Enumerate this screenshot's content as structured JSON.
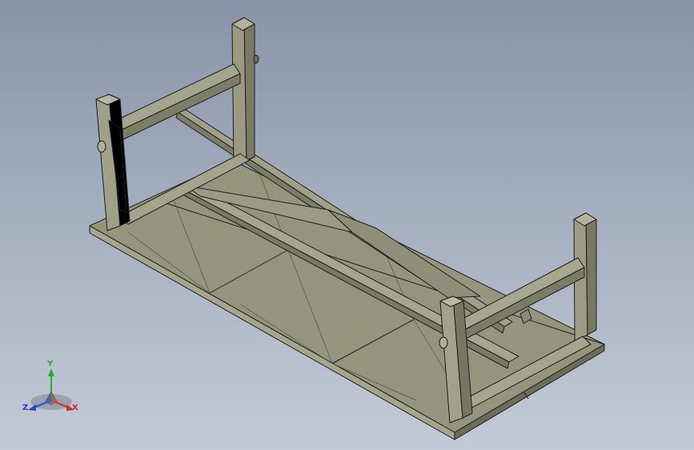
{
  "viewport": {
    "background_top": "#8793a7",
    "background_bottom": "#c3cad6"
  },
  "model": {
    "object": "table-bottom-view",
    "face_color": "#8f8f78",
    "light_face_color": "#a3a38c",
    "dark_face_color": "#74745f",
    "edge_color": "#1e1e1a"
  },
  "triad": {
    "y_label": "Y",
    "x_label": "X",
    "z_label": "Z",
    "y_color": "#1fae2f",
    "x_color": "#d32a2a",
    "z_color": "#2c3fd0"
  }
}
